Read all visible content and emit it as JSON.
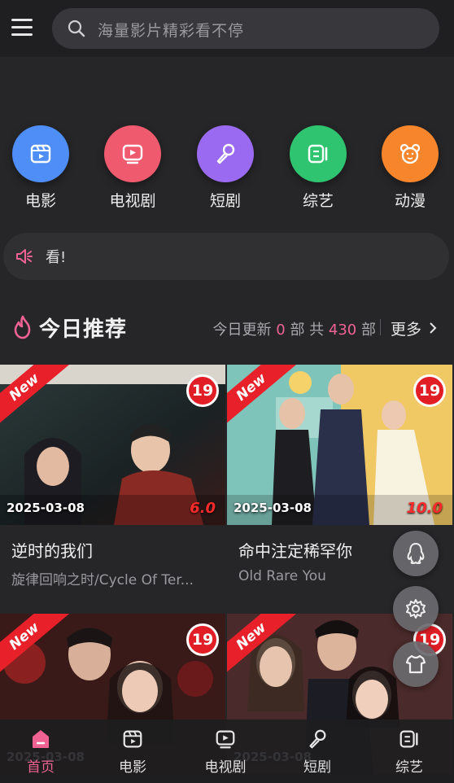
{
  "search": {
    "placeholder": "海量影片精彩看不停"
  },
  "categories": [
    {
      "label": "电影",
      "color": "#4f8ef7",
      "icon": "film-icon"
    },
    {
      "label": "电视剧",
      "color": "#ef5a6f",
      "icon": "tv-icon"
    },
    {
      "label": "短剧",
      "color": "#9a6bf0",
      "icon": "microphone-icon"
    },
    {
      "label": "综艺",
      "color": "#2fc46f",
      "icon": "variety-icon"
    },
    {
      "label": "动漫",
      "color": "#f7852b",
      "icon": "bear-icon"
    }
  ],
  "notice": {
    "text": "看!"
  },
  "section": {
    "title": "今日推荐",
    "stats_prefix": "今日更新",
    "today_count": "0",
    "unit1": "部",
    "total_label": "共",
    "total_count": "430",
    "unit2": "部",
    "more_label": "更多"
  },
  "cards": [
    {
      "badge": "New",
      "age": "19",
      "date": "2025-03-08",
      "score": "6.0",
      "title": "逆时的我们",
      "subtitle": "旋律回响之时/Cycle Of Ter..."
    },
    {
      "badge": "New",
      "age": "19",
      "date": "2025-03-08",
      "score": "10.0",
      "title": "命中注定稀罕你",
      "subtitle": "Old Rare You"
    },
    {
      "badge": "New",
      "age": "19",
      "date": "2025-03-08"
    },
    {
      "badge": "New",
      "age": "19",
      "date": "2025-03-08"
    }
  ],
  "floating_buttons": [
    "qq-icon",
    "settings-icon",
    "shirt-icon"
  ],
  "tabbar": {
    "items": [
      {
        "label": "首页",
        "icon": "home-icon",
        "active": true
      },
      {
        "label": "电影",
        "icon": "film-icon"
      },
      {
        "label": "电视剧",
        "icon": "tv-icon"
      },
      {
        "label": "短剧",
        "icon": "microphone-icon"
      },
      {
        "label": "综艺",
        "icon": "variety-icon"
      }
    ]
  },
  "colors": {
    "accent": "#f06292",
    "background": "#262628",
    "badge_red": "#e11d25"
  }
}
